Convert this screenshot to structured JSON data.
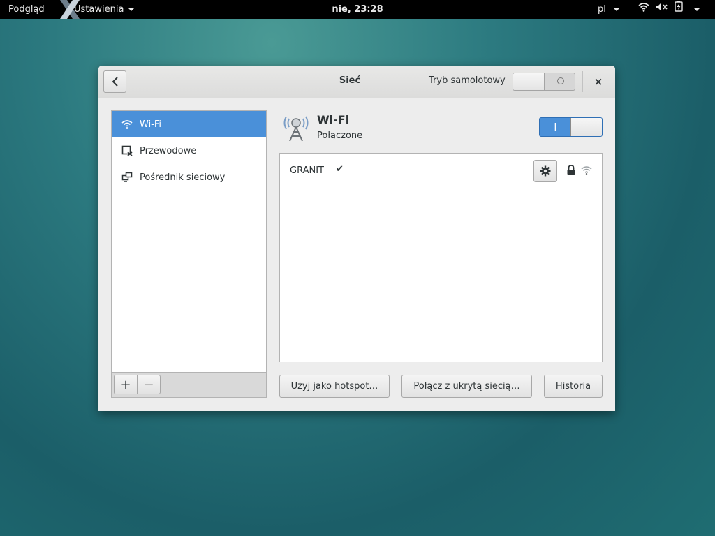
{
  "topbar": {
    "activities": "Podgląd",
    "app_name": "Ustawienia",
    "clock": "nie, 23:28",
    "language": "pl",
    "icons": [
      "wifi-icon",
      "volume-muted-icon",
      "battery-charging-icon",
      "system-menu-caret-icon"
    ]
  },
  "window": {
    "title": "Sieć",
    "airplane_mode_label": "Tryb samolotowy",
    "airplane_mode_on": false,
    "close_label": "×"
  },
  "sidebar": {
    "items": [
      {
        "label": "Wi-Fi",
        "icon": "wifi-icon",
        "selected": true
      },
      {
        "label": "Przewodowe",
        "icon": "wired-disconnected-icon",
        "selected": false
      },
      {
        "label": "Pośrednik sieciowy",
        "icon": "proxy-icon",
        "selected": false
      }
    ],
    "add_label": "+",
    "remove_label": "−"
  },
  "device": {
    "name": "Wi-Fi",
    "status": "Połączone",
    "switch_on": true,
    "switch_on_label": "I"
  },
  "networks": [
    {
      "ssid": "GRANIT",
      "connected_mark": "✔",
      "secured": true,
      "signal": "strong"
    }
  ],
  "buttons": {
    "hotspot": "Użyj jako hotspot…",
    "hidden": "Połącz z ukrytą siecią…",
    "history": "Historia"
  },
  "colors": {
    "accent": "#4a90d9",
    "topbar": "#000000"
  }
}
